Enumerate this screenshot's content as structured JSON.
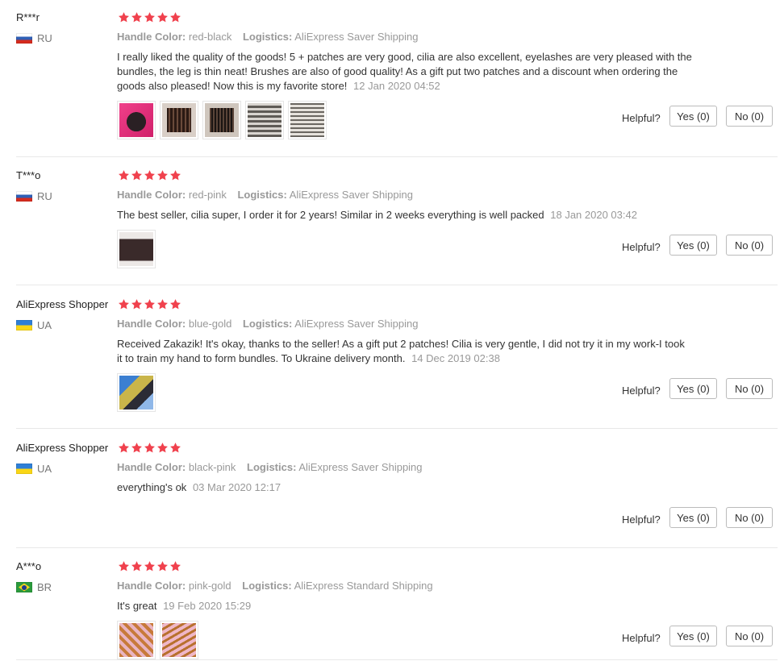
{
  "colors": {
    "star": "#f0414d",
    "meta": "#999999",
    "text": "#333333",
    "separator": "#e8e8e8"
  },
  "labels": {
    "handle_color": "Handle Color:",
    "logistics": "Logistics:",
    "helpful": "Helpful?",
    "yes": "Yes (0)",
    "no": "No (0)"
  },
  "reviews": [
    {
      "user": "R***r",
      "country": "RU",
      "flag": "ru",
      "rating": 5,
      "handle_color": "red-black",
      "logistics": "AliExpress Saver Shipping",
      "text": "I really liked the quality of the goods! 5 + patches are very good, cilia are also excellent, eyelashes are very pleased with the bundles, the leg is thin neat! Brushes are also of good quality! As a gift put two patches and a discount when ordering the goods also pleased! Now this is my favorite store!",
      "date": "12 Jan 2020 04:52",
      "thumbnails": [
        "pink-pad-photo",
        "lash-tray-photo",
        "lash-tray-photo",
        "lash-box-photo",
        "lash-box-photo"
      ]
    },
    {
      "user": "T***o",
      "country": "RU",
      "flag": "ru",
      "rating": 5,
      "handle_color": "red-pink",
      "logistics": "AliExpress Saver Shipping",
      "text": "The best seller, cilia super, I order it for 2 years! Similar in 2 weeks everything is well packed",
      "date": "18 Jan 2020 03:42",
      "thumbnails": [
        "package-photo"
      ]
    },
    {
      "user": "AliExpress Shopper",
      "country": "UA",
      "flag": "ua",
      "rating": 5,
      "handle_color": "blue-gold",
      "logistics": "AliExpress Saver Shipping",
      "text": "Received Zakazik! It's okay, thanks to the seller! As a gift put 2 patches! Cilia is very gentle, I did not try it in my work-I took it to train my hand to form bundles. To Ukraine delivery month.",
      "date": "14 Dec 2019 02:38",
      "thumbnails": [
        "product-photo"
      ]
    },
    {
      "user": "AliExpress Shopper",
      "country": "UA",
      "flag": "ua",
      "rating": 5,
      "handle_color": "black-pink",
      "logistics": "AliExpress Saver Shipping",
      "text": "everything's ok",
      "date": "03 Mar 2020 12:17",
      "thumbnails": []
    },
    {
      "user": "A***o",
      "country": "BR",
      "flag": "br",
      "rating": 5,
      "handle_color": "pink-gold",
      "logistics": "AliExpress Standard Shipping",
      "text": "It's great",
      "date": "19 Feb 2020 15:29",
      "thumbnails": [
        "tweezers-photo",
        "tweezers-photo"
      ]
    }
  ]
}
